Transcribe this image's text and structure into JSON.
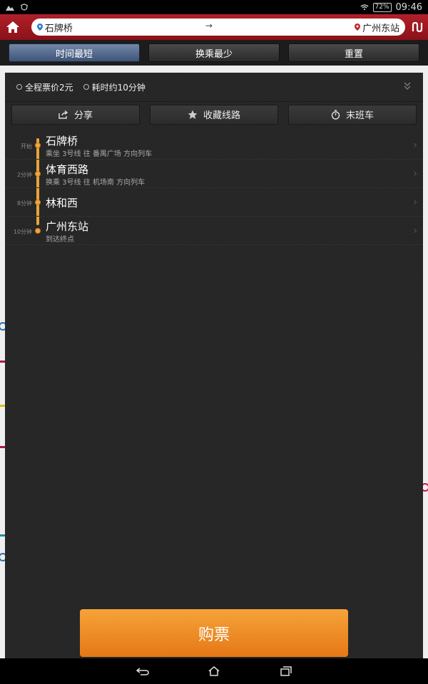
{
  "status": {
    "battery": "72%",
    "time": "09:46"
  },
  "topbar": {
    "from_station": "石牌桥",
    "arrow": "→",
    "to_station": "广州东站"
  },
  "tabs": [
    {
      "label": "时间最短",
      "active": true
    },
    {
      "label": "换乘最少",
      "active": false
    },
    {
      "label": "重置",
      "active": false
    }
  ],
  "summary": {
    "fare": "全程票价2元",
    "duration": "耗时约10分钟"
  },
  "actions": {
    "share": "分享",
    "favorite": "收藏线路",
    "last_train": "末班车"
  },
  "stops": [
    {
      "time": "开始",
      "name": "石牌桥",
      "desc": "乘坐 3号线 往 番禺广场 方向列车"
    },
    {
      "time": "2分钟",
      "name": "体育西路",
      "desc": "换乘 3号线 往 机场南 方向列车"
    },
    {
      "time": "8分钟",
      "name": "林和西",
      "desc": ""
    },
    {
      "time": "10分钟",
      "name": "广州东站",
      "desc": "到达终点"
    }
  ],
  "buy_label": "购票",
  "colors": {
    "accent": "#e8a33a",
    "header": "#a11a23",
    "buy": "#f08a26"
  }
}
